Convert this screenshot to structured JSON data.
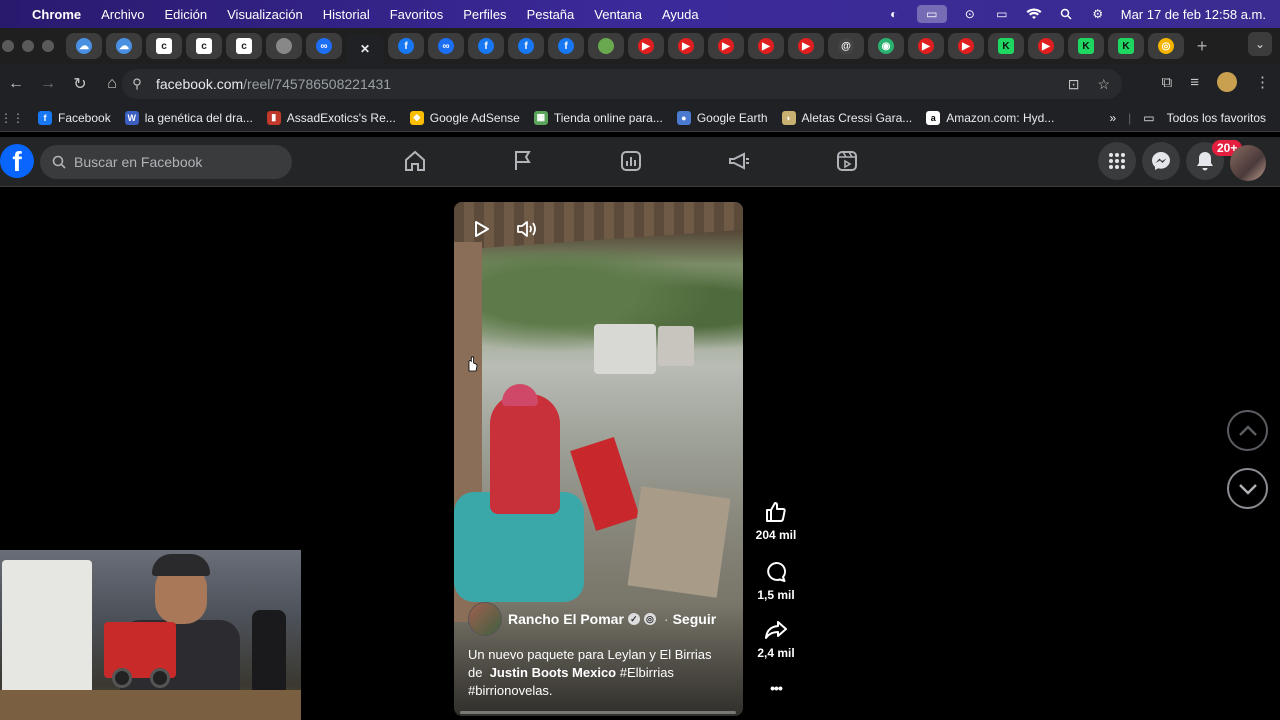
{
  "menubar": {
    "app": "Chrome",
    "items": [
      "Archivo",
      "Edición",
      "Visualización",
      "Historial",
      "Favoritos",
      "Perfiles",
      "Pestaña",
      "Ventana",
      "Ayuda"
    ],
    "datetime": "Mar 17 de feb  12:58 a.m."
  },
  "tabs": {
    "favicons": [
      "cloud-icon",
      "cloud-icon",
      "c-icon",
      "c-icon",
      "c-icon",
      "blank-icon",
      "meta-icon",
      "close-icon",
      "facebook-icon",
      "meta-icon",
      "facebook-icon",
      "facebook-icon",
      "facebook-icon",
      "green-icon",
      "youtube-icon",
      "youtube-icon",
      "youtube-icon",
      "youtube-icon",
      "youtube-icon",
      "threads-icon",
      "cam-icon",
      "youtube-icon",
      "youtube-icon",
      "k-icon",
      "youtube-icon",
      "k-icon",
      "k-icon",
      "chrome-icon"
    ],
    "new_tab": "+"
  },
  "address": {
    "host": "facebook.com",
    "path": "/reel/745786508221431"
  },
  "bookmarks": {
    "items": [
      {
        "label": "Facebook",
        "color": "#1877f2",
        "glyph": "f"
      },
      {
        "label": "la genética del dra...",
        "color": "#3b5fc0",
        "glyph": "W"
      },
      {
        "label": "AssadExotics's Re...",
        "color": "#c0392b",
        "glyph": "▮"
      },
      {
        "label": "Google AdSense",
        "color": "#fbbc04",
        "glyph": "◆"
      },
      {
        "label": "Tienda online para...",
        "color": "#5aa55a",
        "glyph": "▦"
      },
      {
        "label": "Google Earth",
        "color": "#4a7bd0",
        "glyph": "●"
      },
      {
        "label": "Aletas Cressi Gara...",
        "color": "#c8b070",
        "glyph": "◗"
      },
      {
        "label": "Amazon.com: Hyd...",
        "color": "#ffffff",
        "glyph": "a"
      }
    ],
    "more": "»",
    "all_favorites": "Todos los favoritos"
  },
  "facebook": {
    "search_placeholder": "Buscar en Facebook",
    "notifications_badge": "20+"
  },
  "reel": {
    "author": "Rancho El Pomar",
    "follow": "Seguir",
    "caption_line1": "Un nuevo paquete para Leylan y El Birrias",
    "caption_prefix": "de",
    "caption_bold": "Justin Boots Mexico",
    "caption_tags1": "#Elbirrias",
    "caption_tags2": "#birrionovelas."
  },
  "actions": {
    "likes": "204 mil",
    "comments": "1,5 mil",
    "shares": "2,4 mil",
    "more": "•••"
  }
}
